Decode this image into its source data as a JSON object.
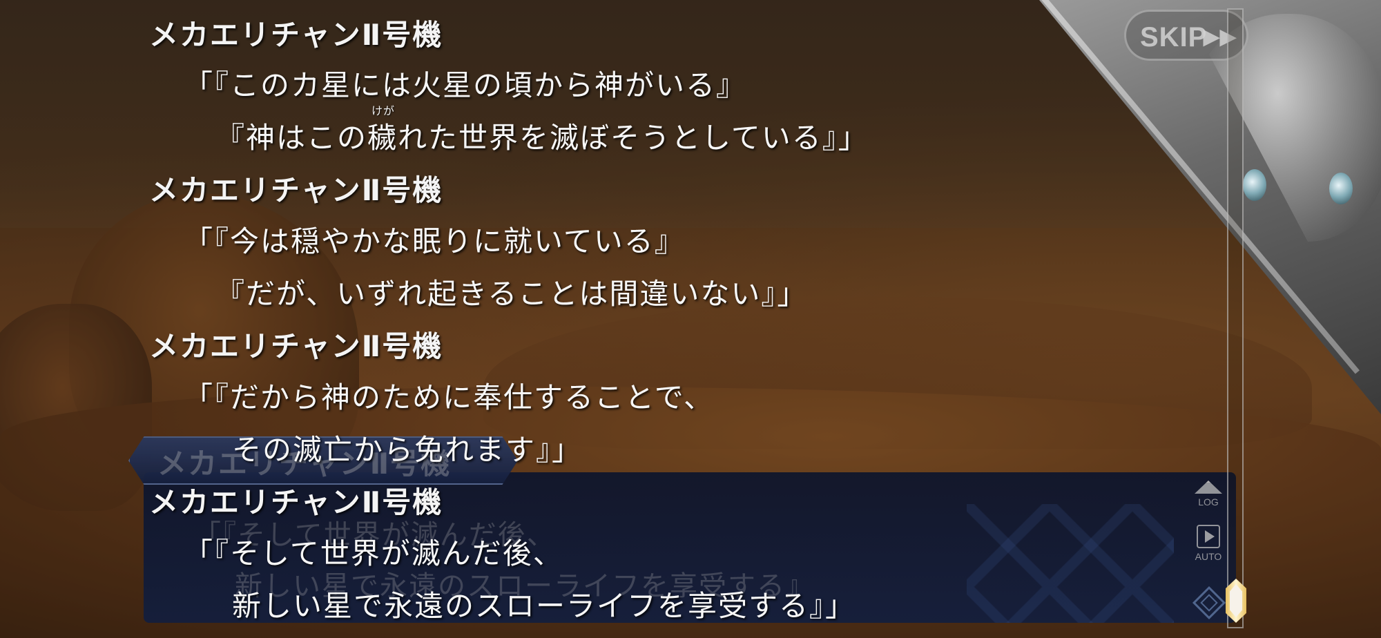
{
  "skip": {
    "label": "SKIP",
    "glyph": "▶▶"
  },
  "side_buttons": {
    "log_label": "LOG",
    "auto_label": "AUTO"
  },
  "name_plate": {
    "speaker": "メカエリチャンⅡ号機"
  },
  "dialog_box": {
    "line1": "「『そして世界が滅んだ後、",
    "line2": "新しい星で永遠のスローライフを享受する』"
  },
  "log": {
    "entries": [
      {
        "speaker": "メカエリチャンⅡ号機",
        "line1": "「『このカ星には火星の頃から神がいる』",
        "line2": "『神はこの穢れた世界を滅ぼそうとしている』」",
        "ruby": "けが"
      },
      {
        "speaker": "メカエリチャンⅡ号機",
        "line1": "「『今は穏やかな眠りに就いている』",
        "line2": "『だが、いずれ起きることは間違いない』」"
      },
      {
        "speaker": "メカエリチャンⅡ号機",
        "line1": "「『だから神のために奉仕することで、",
        "line2": "その滅亡から免れます』」"
      },
      {
        "speaker": "メカエリチャンⅡ号機",
        "line1": "「『そして世界が滅んだ後、",
        "line2": "新しい星で永遠のスローライフを享受する』」"
      }
    ]
  },
  "colors": {
    "dialog_bg": "#121e3e",
    "text": "#f7f7f7",
    "scroll_thumb": "#e8c060"
  }
}
